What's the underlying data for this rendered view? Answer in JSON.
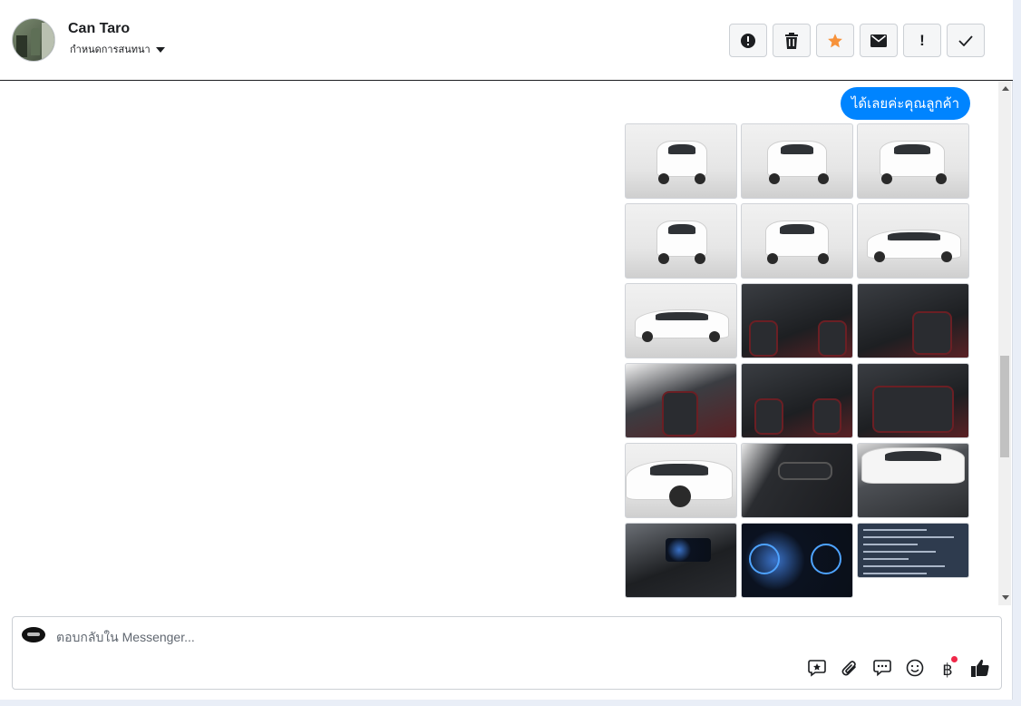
{
  "header": {
    "contact_name": "Can Taro",
    "assign_label": "กำหนดการสนทนา",
    "actions": [
      {
        "name": "report-button",
        "icon": "alert-circle-icon"
      },
      {
        "name": "delete-button",
        "icon": "trash-icon"
      },
      {
        "name": "star-button",
        "icon": "star-icon"
      },
      {
        "name": "mark-unread-button",
        "icon": "envelope-icon"
      },
      {
        "name": "mark-important-button",
        "icon": "exclamation-icon",
        "glyph": "!"
      },
      {
        "name": "mark-done-button",
        "icon": "check-icon"
      }
    ]
  },
  "thread": {
    "message_text": "ได้เลยค่ะคุณลูกค้า",
    "photos": [
      "car-front",
      "car-front-angle",
      "car-rear-angle",
      "car-rear",
      "car-front-angle",
      "car-side",
      "car-side",
      "interior-dashboard",
      "interior-front-seat",
      "interior-front-seats",
      "interior-cabin",
      "interior-rear-seats",
      "car-closeup",
      "interior-door",
      "engine-bay",
      "steering-wheel",
      "instrument-cluster",
      "spec-sheet"
    ]
  },
  "composer": {
    "placeholder": "ตอบกลับใน Messenger...",
    "value": "",
    "tools": [
      "saved-reply-icon",
      "attachment-icon",
      "chat-bubble-icon",
      "emoji-icon",
      "baht-payment-icon",
      "like-icon"
    ]
  },
  "colors": {
    "bubble": "#0084ff",
    "star": "#f7923a",
    "notification_dot": "#f02849"
  }
}
